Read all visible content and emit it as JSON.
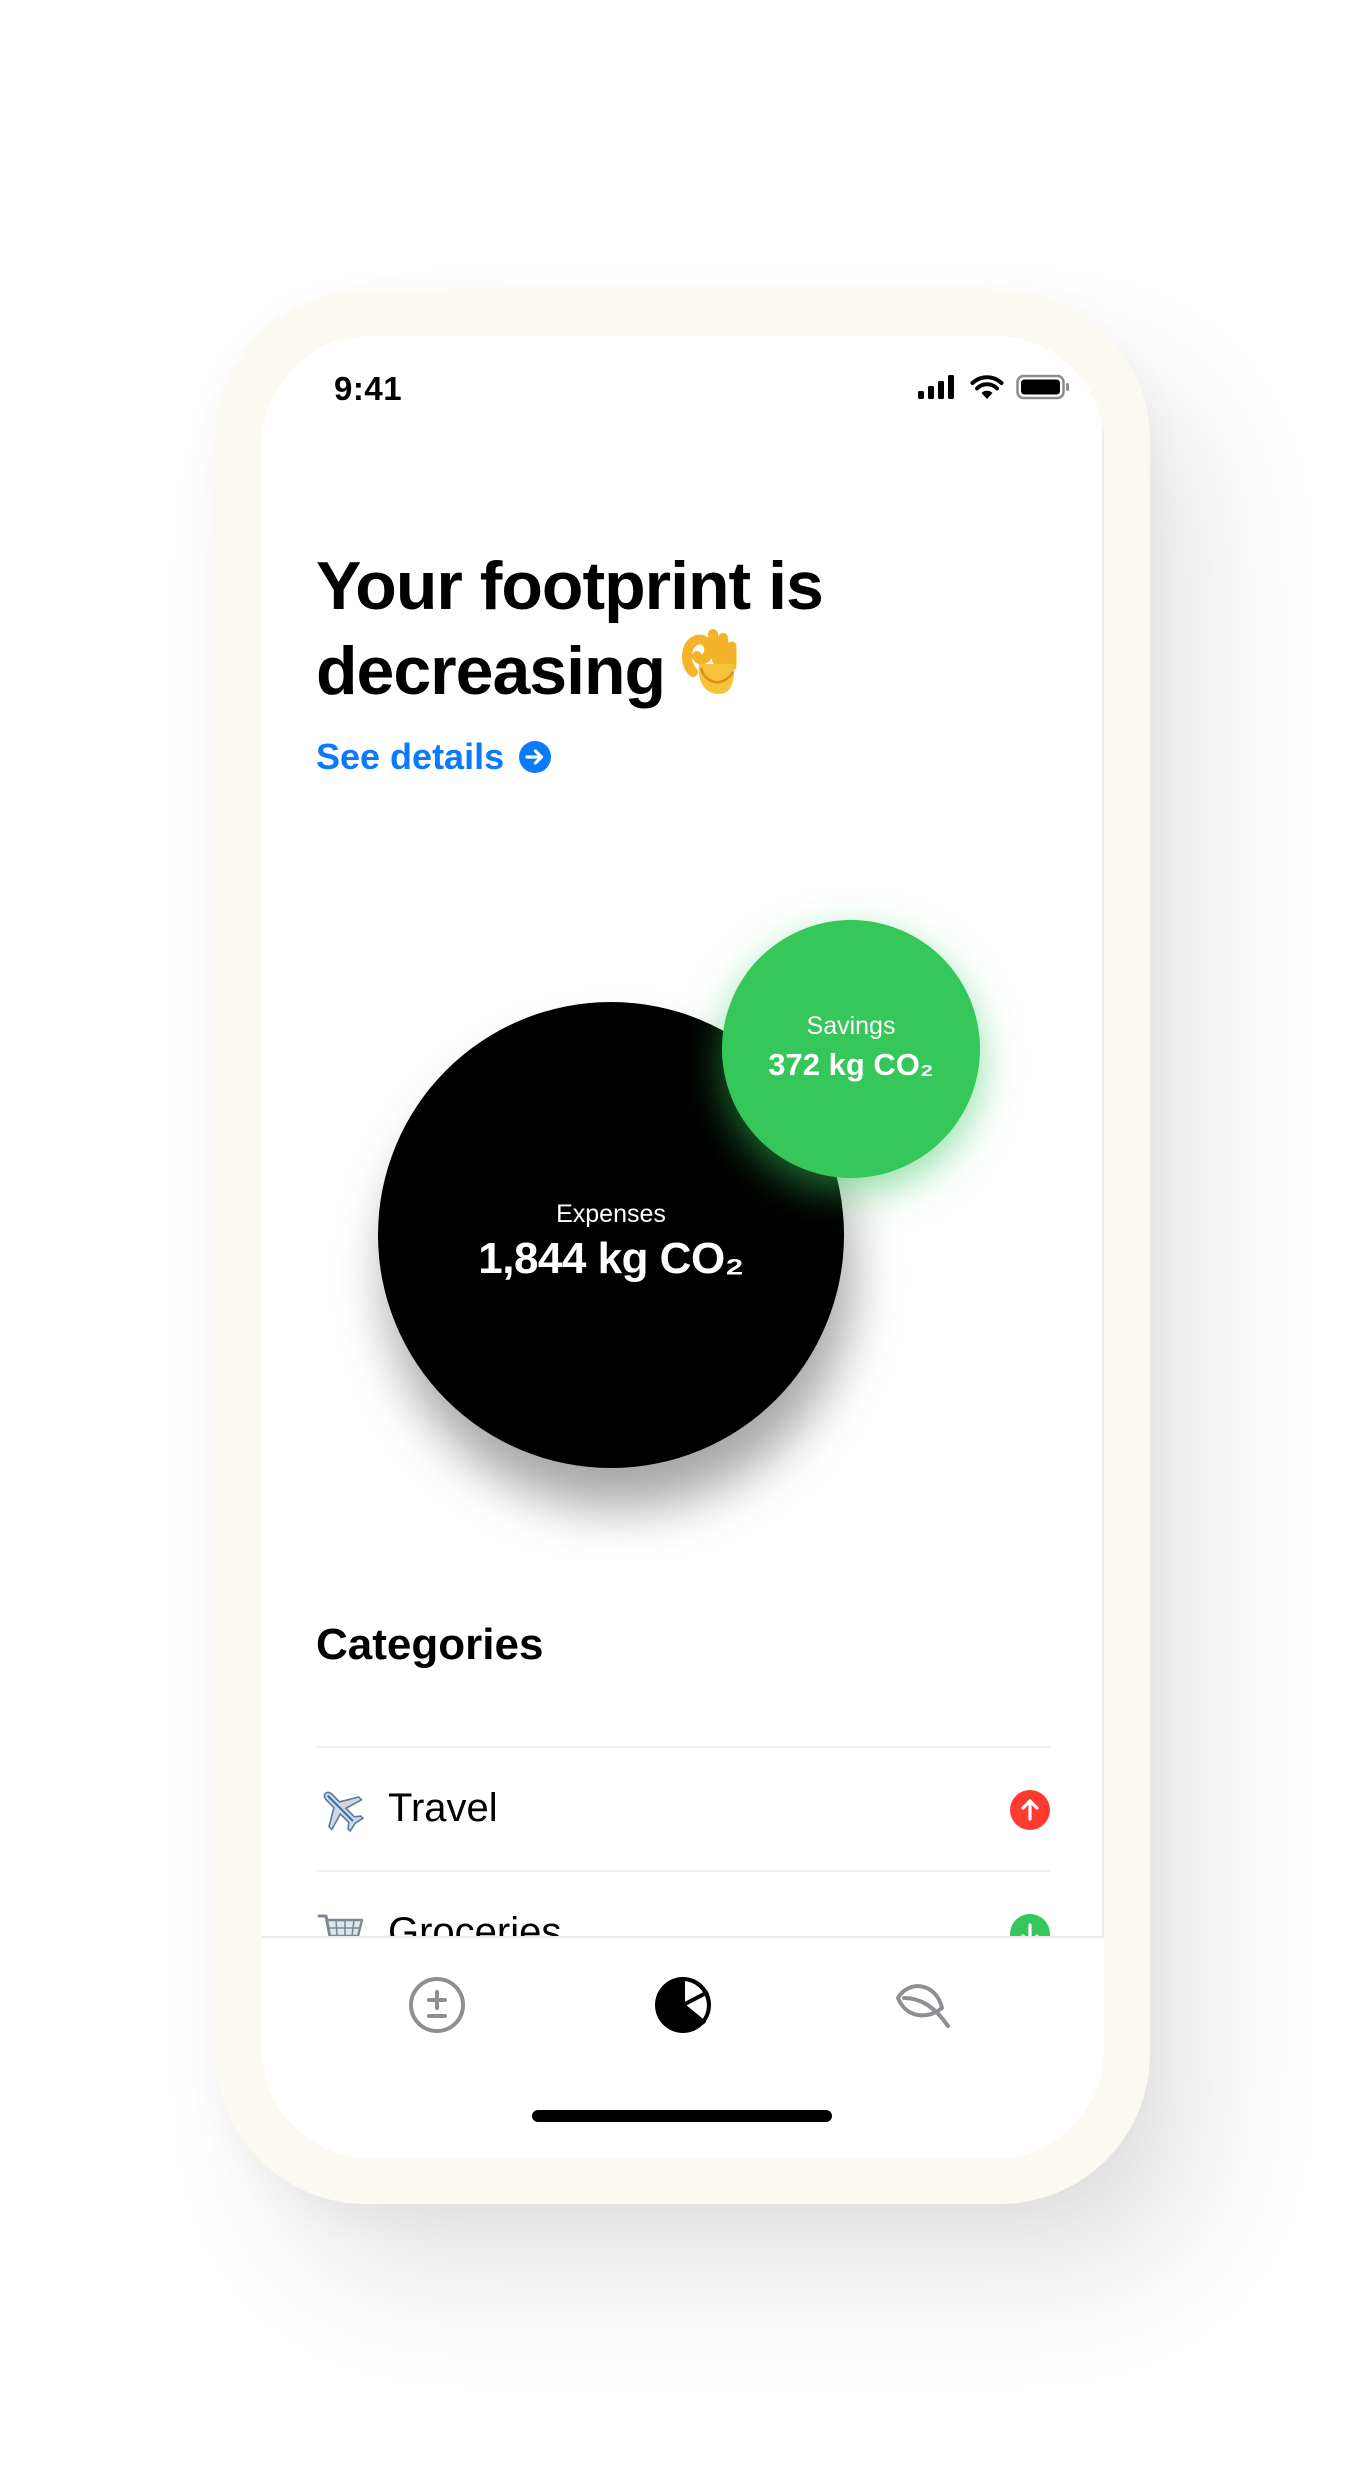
{
  "status_bar": {
    "time": "9:41"
  },
  "headline": {
    "line1": "Your footprint is",
    "line2": "decreasing",
    "emoji_icon": "ok-hand-icon"
  },
  "see_details": {
    "label": "See details",
    "icon": "arrow-right-circle-icon"
  },
  "expenses": {
    "label": "Expenses",
    "value": "1,844 kg CO₂"
  },
  "savings": {
    "label": "Savings",
    "value": "372 kg CO₂"
  },
  "categories": {
    "title": "Categories",
    "items": [
      {
        "icon": "airplane-icon",
        "label": "Travel",
        "trend": "up",
        "trend_color": "#ff3b30"
      },
      {
        "icon": "shopping-cart-icon",
        "label": "Groceries",
        "trend": "down",
        "trend_color": "#34c759"
      }
    ]
  },
  "tabbar": {
    "tabs": [
      {
        "icon": "plus-minus-icon",
        "active": false
      },
      {
        "icon": "pie-chart-icon",
        "active": true
      },
      {
        "icon": "leaf-icon",
        "active": false
      }
    ]
  },
  "colors": {
    "accent_blue": "#0a7aff",
    "savings_green": "#35c759",
    "expenses_black": "#000000",
    "trend_up_red": "#ff3b30",
    "trend_down_green": "#34c759"
  }
}
